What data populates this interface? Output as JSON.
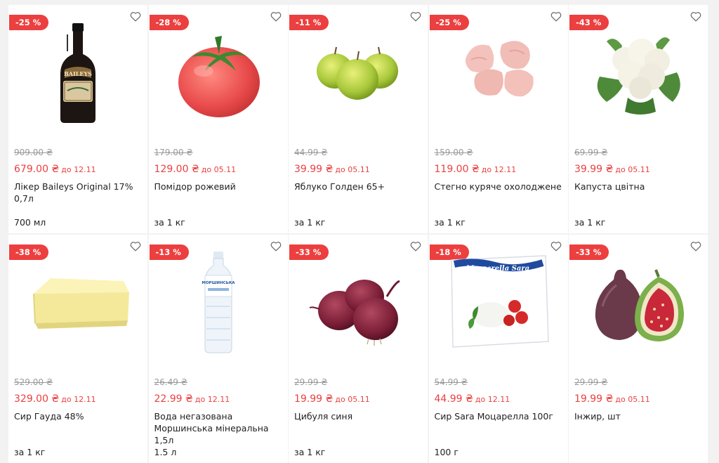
{
  "products": [
    {
      "discount": "-25 %",
      "old_price": "909.00 ₴",
      "price": "679.00 ₴",
      "until": "до 12.11",
      "name": "Лікер Baileys Original 17% 0,7л",
      "unit": "700 мл",
      "image": "bottle"
    },
    {
      "discount": "-28 %",
      "old_price": "179.00 ₴",
      "price": "129.00 ₴",
      "until": "до 05.11",
      "name": "Помідор рожевий",
      "unit": "за 1 кг",
      "image": "tomato"
    },
    {
      "discount": "-11 %",
      "old_price": "44.99 ₴",
      "price": "39.99 ₴",
      "until": "до 05.11",
      "name": "Яблуко Голден 65+",
      "unit": "за 1 кг",
      "image": "apples"
    },
    {
      "discount": "-25 %",
      "old_price": "159.00 ₴",
      "price": "119.00 ₴",
      "until": "до 12.11",
      "name": "Стегно куряче охолоджене",
      "unit": "за 1 кг",
      "image": "chicken"
    },
    {
      "discount": "-43 %",
      "old_price": "69.99 ₴",
      "price": "39.99 ₴",
      "until": "до 05.11",
      "name": "Капуста цвітна",
      "unit": "за 1 кг",
      "image": "cauliflower"
    },
    {
      "discount": "-38 %",
      "old_price": "529.00 ₴",
      "price": "329.00 ₴",
      "until": "до 12.11",
      "name": "Сир Гауда 48%",
      "unit": "за 1 кг",
      "image": "cheese"
    },
    {
      "discount": "-13 %",
      "old_price": "26.49 ₴",
      "price": "22.99 ₴",
      "until": "до 12.11",
      "name": "Вода негазована Моршинська мінеральна 1,5л",
      "unit": "1.5 л",
      "image": "water"
    },
    {
      "discount": "-33 %",
      "old_price": "29.99 ₴",
      "price": "19.99 ₴",
      "until": "до 05.11",
      "name": "Цибуля синя",
      "unit": "за 1 кг",
      "image": "onion"
    },
    {
      "discount": "-18 %",
      "old_price": "54.99 ₴",
      "price": "44.99 ₴",
      "until": "до 12.11",
      "name": "Сир Sara Моцарелла 100г",
      "unit": "100 г",
      "image": "mozzarella"
    },
    {
      "discount": "-33 %",
      "old_price": "29.99 ₴",
      "price": "19.99 ₴",
      "until": "до 05.11",
      "name": "Інжир, шт",
      "unit": "",
      "image": "figs"
    }
  ],
  "product_image_labels": {
    "bottle": "BAILEYS",
    "mozzarella": "Mozzarella Sara",
    "water": "МОРШИНСЬКА"
  },
  "colors": {
    "accent": "#ec3f3f",
    "old_price": "#9a9a9a",
    "text": "#222222",
    "background": "#f2f2f2"
  },
  "icons": {
    "favorite": "heart-outline-icon"
  }
}
